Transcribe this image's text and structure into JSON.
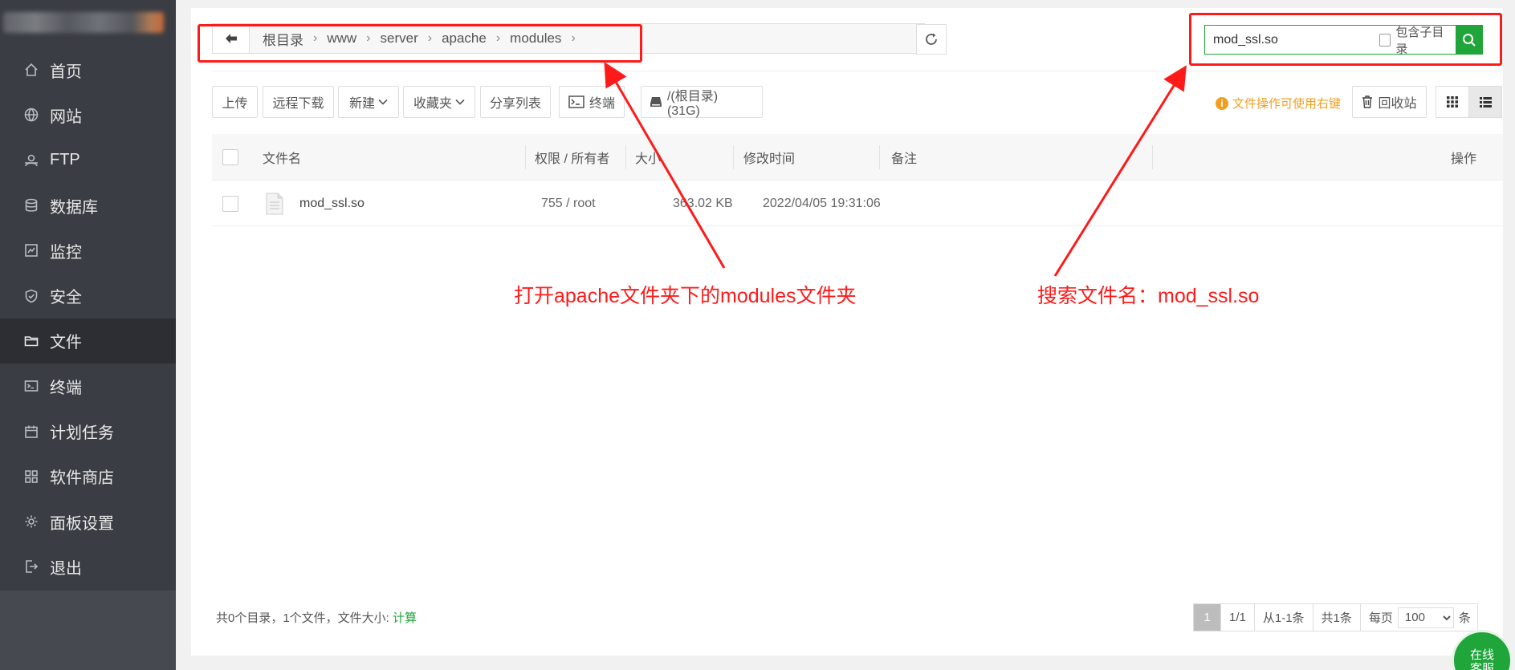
{
  "sidebar": {
    "items": [
      {
        "label": "首页",
        "icon": "home-icon"
      },
      {
        "label": "网站",
        "icon": "globe-icon"
      },
      {
        "label": "FTP",
        "icon": "ftp-icon"
      },
      {
        "label": "数据库",
        "icon": "database-icon"
      },
      {
        "label": "监控",
        "icon": "monitor-icon"
      },
      {
        "label": "安全",
        "icon": "shield-icon"
      },
      {
        "label": "文件",
        "icon": "folder-icon",
        "active": true
      },
      {
        "label": "终端",
        "icon": "terminal-icon"
      },
      {
        "label": "计划任务",
        "icon": "calendar-icon"
      },
      {
        "label": "软件商店",
        "icon": "apps-icon"
      },
      {
        "label": "面板设置",
        "icon": "gear-icon"
      },
      {
        "label": "退出",
        "icon": "logout-icon"
      }
    ]
  },
  "pathbar": {
    "crumbs": [
      "根目录",
      "www",
      "server",
      "apache",
      "modules"
    ]
  },
  "search": {
    "value": "mod_ssl.so",
    "include_sub_label": "包含子目录"
  },
  "toolbar": {
    "upload": "上传",
    "remote_download": "远程下载",
    "new": "新建",
    "favorites": "收藏夹",
    "share_list": "分享列表",
    "terminal": "终端",
    "disk": "/(根目录) (31G)",
    "tip": "文件操作可使用右键",
    "recycle": "回收站"
  },
  "table": {
    "headers": {
      "name": "文件名",
      "perm": "权限 / 所有者",
      "size": "大小",
      "mtime": "修改时间",
      "note": "备注",
      "ops": "操作"
    },
    "rows": [
      {
        "name": "mod_ssl.so",
        "perm": "755 / root",
        "size": "363.02 KB",
        "mtime": "2022/04/05 19:31:06",
        "note": ""
      }
    ]
  },
  "footer": {
    "summary": "共0个目录，1个文件，文件大小:",
    "calc": "计算",
    "page_current": "1",
    "page_total": "1/1",
    "range": "从1-1条",
    "count": "共1条",
    "per_page_label": "每页",
    "per_page": "100",
    "per_page_unit": "条"
  },
  "service": {
    "line1": "在线",
    "line2": "客服"
  },
  "annotations": {
    "left": "打开apache文件夹下的modules文件夹",
    "right": "搜索文件名：mod_ssl.so"
  },
  "colors": {
    "accent": "#20a53a",
    "annotation": "#ff1a1a",
    "tip": "#f0a020",
    "sidebar": "#3a3d43"
  }
}
